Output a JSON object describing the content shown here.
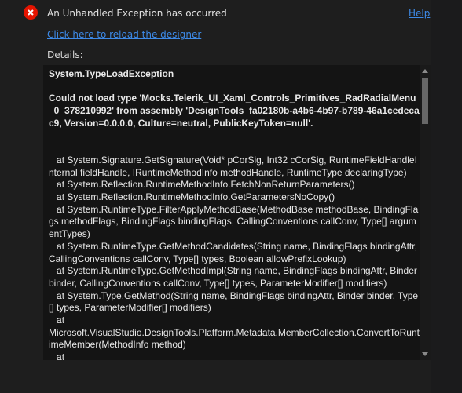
{
  "header": {
    "title": "An Unhandled Exception has occurred",
    "help_link": "Help",
    "reload_link": "Click here to reload the designer",
    "details_label": "Details:"
  },
  "details": {
    "exception_type": "System.TypeLoadException",
    "message": "Could not load type 'Mocks.Telerik_UI_Xaml_Controls_Primitives_RadRadialMenu_0_378210992' from assembly 'DesignTools_fa02180b-a4b6-4b97-b789-46a1cedecac9, Version=0.0.0.0, Culture=neutral, PublicKeyToken=null'.",
    "stack_trace": "   at System.Signature.GetSignature(Void* pCorSig, Int32 cCorSig, RuntimeFieldHandleInternal fieldHandle, IRuntimeMethodInfo methodHandle, RuntimeType declaringType)\n   at System.Reflection.RuntimeMethodInfo.FetchNonReturnParameters()\n   at System.Reflection.RuntimeMethodInfo.GetParametersNoCopy()\n   at System.RuntimeType.FilterApplyMethodBase(MethodBase methodBase, BindingFlags methodFlags, BindingFlags bindingFlags, CallingConventions callConv, Type[] argumentTypes)\n   at System.RuntimeType.GetMethodCandidates(String name, BindingFlags bindingAttr, CallingConventions callConv, Type[] types, Boolean allowPrefixLookup)\n   at System.RuntimeType.GetMethodImpl(String name, BindingFlags bindingAttr, Binder binder, CallingConventions callConv, Type[] types, ParameterModifier[] modifiers)\n   at System.Type.GetMethod(String name, BindingFlags bindingAttr, Binder binder, Type[] types, ParameterModifier[] modifiers)\n   at\nMicrosoft.VisualStudio.DesignTools.Platform.Metadata.MemberCollection.ConvertToRuntimeMember(MethodInfo method)\n   at"
  },
  "colors": {
    "error_icon": "#e51400",
    "link": "#3d8ae8",
    "background": "#1e1e1e"
  },
  "icons": {
    "error": "error-circle-x-icon"
  }
}
